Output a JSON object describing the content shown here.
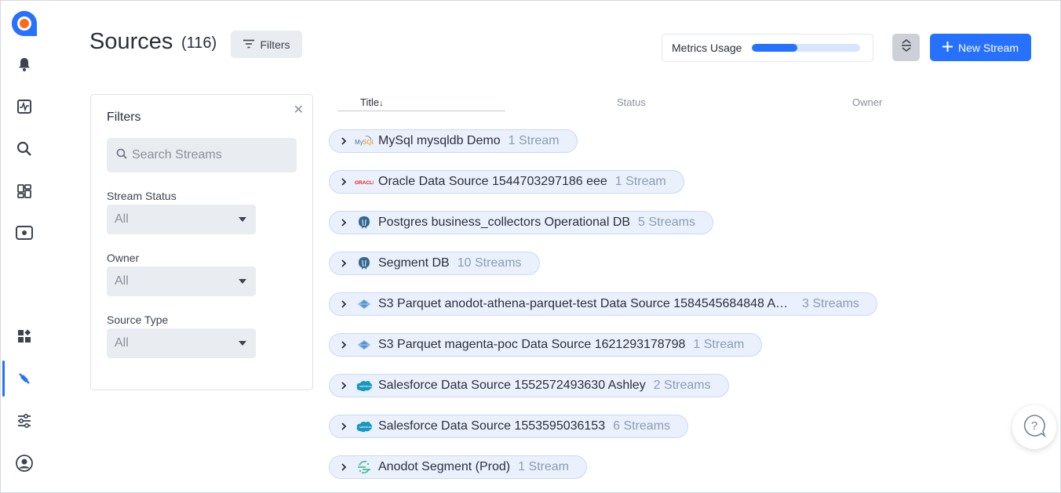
{
  "nav": {
    "items": [
      {
        "name": "alerts-icon"
      },
      {
        "name": "activity-icon"
      },
      {
        "name": "search-icon"
      },
      {
        "name": "dashboards-icon"
      },
      {
        "name": "monitor-icon"
      },
      {
        "name": "widgets-icon"
      },
      {
        "name": "integrations-icon"
      },
      {
        "name": "settings-icon"
      },
      {
        "name": "user-avatar-icon"
      }
    ],
    "active": "integrations-icon"
  },
  "header": {
    "title": "Sources",
    "count": "(116)",
    "filters_label": "Filters",
    "metrics_label": "Metrics Usage",
    "metrics_usage_percent": 42,
    "new_stream_label": "New Stream"
  },
  "filters_panel": {
    "title": "Filters",
    "search_placeholder": "Search Streams",
    "stream_status_label": "Stream Status",
    "stream_status_value": "All",
    "owner_label": "Owner",
    "owner_value": "All",
    "source_type_label": "Source Type",
    "source_type_value": "All"
  },
  "table": {
    "columns": {
      "title": "Title",
      "sort_indicator": "↓",
      "status": "Status",
      "owner": "Owner"
    },
    "rows": [
      {
        "type": "mysql",
        "name": "MySql mysqldb Demo",
        "count": "1 Stream"
      },
      {
        "type": "oracle",
        "name": "Oracle Data Source 1544703297186 eee",
        "count": "1 Stream"
      },
      {
        "type": "postgres",
        "name": "Postgres business_collectors Operational DB",
        "count": "5 Streams"
      },
      {
        "type": "postgres",
        "name": "Segment DB",
        "count": "10 Streams"
      },
      {
        "type": "s3parquet",
        "name": "S3 Parquet anodot-athena-parquet-test Data Source 1584545684848 As…",
        "count": "3 Streams"
      },
      {
        "type": "s3parquet",
        "name": "S3 Parquet magenta-poc Data Source 1621293178798",
        "count": "1 Stream"
      },
      {
        "type": "salesforce",
        "name": "Salesforce Data Source 1552572493630 Ashley",
        "count": "2 Streams"
      },
      {
        "type": "salesforce",
        "name": "Salesforce Data Source 1553595036153",
        "count": "6 Streams"
      },
      {
        "type": "segment",
        "name": "Anodot Segment (Prod)",
        "count": "1 Stream"
      }
    ]
  },
  "colors": {
    "accent": "#2671ff",
    "row_bg": "#eaf1fd",
    "count_text": "#8a9bb3"
  }
}
